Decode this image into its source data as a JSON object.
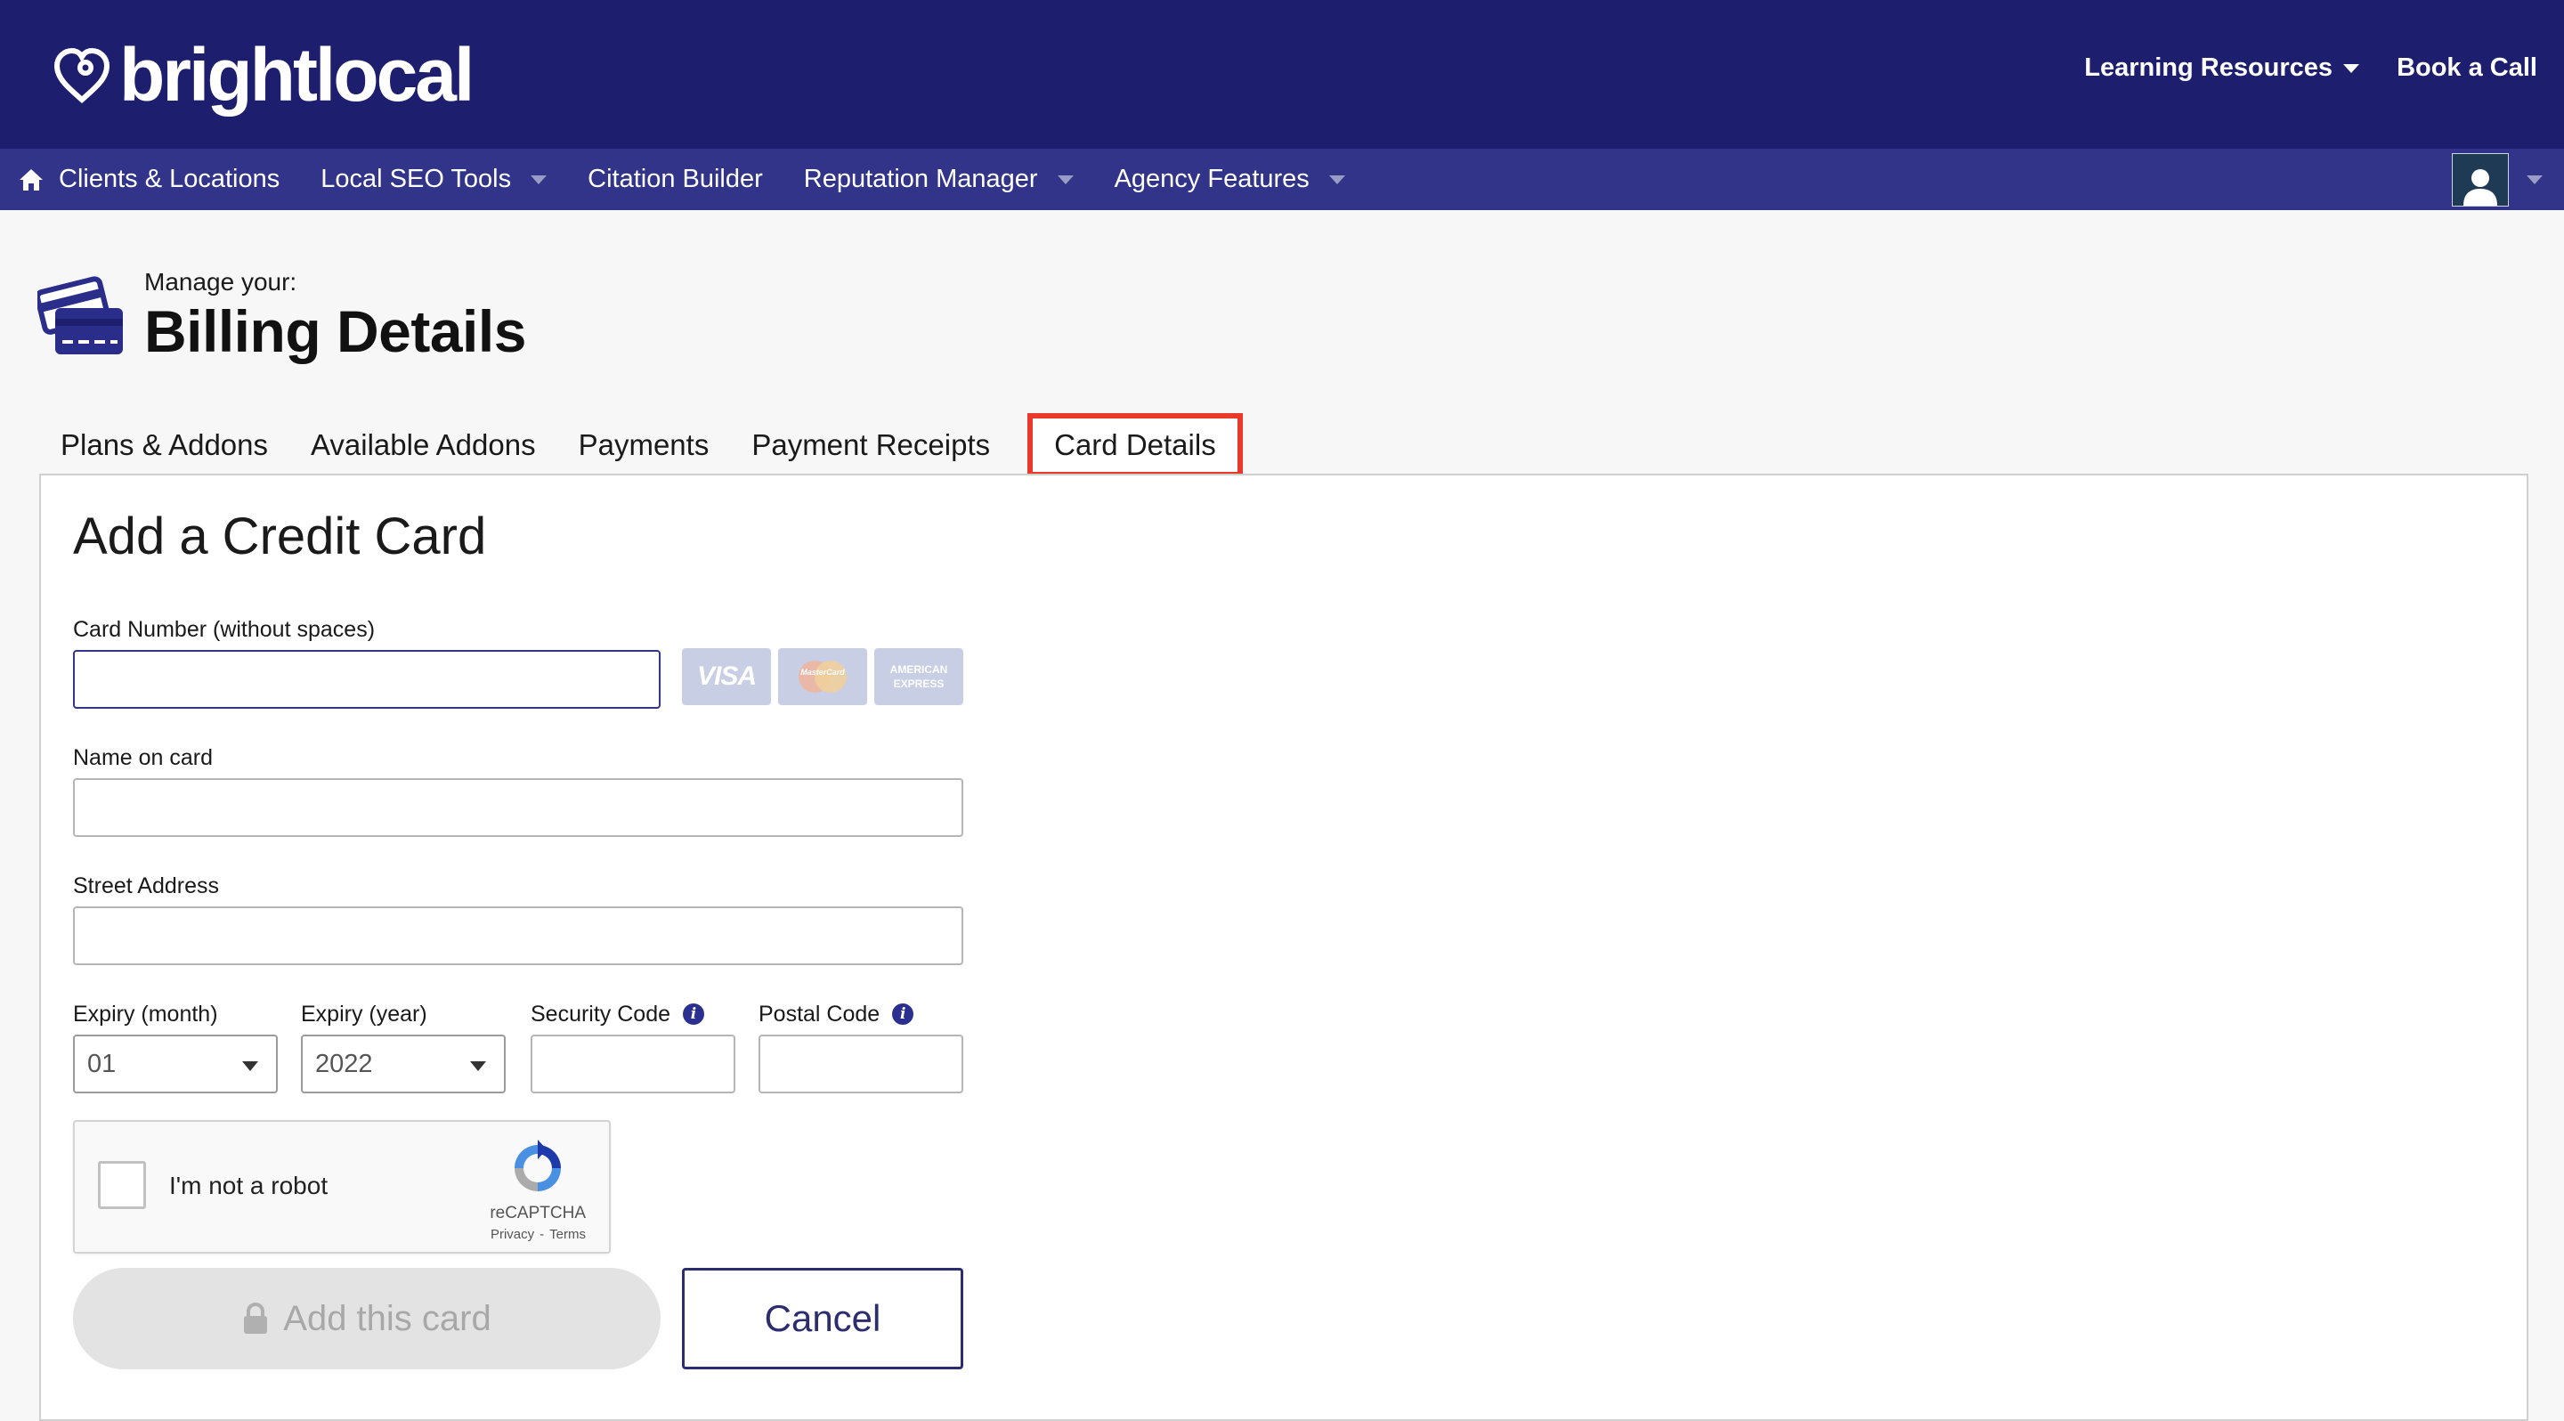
{
  "brand": {
    "name": "brightlocal"
  },
  "top_links": {
    "learning": "Learning Resources",
    "book": "Book a Call"
  },
  "nav": {
    "items": [
      {
        "label": "Clients & Locations"
      },
      {
        "label": "Local SEO Tools"
      },
      {
        "label": "Citation Builder"
      },
      {
        "label": "Reputation Manager"
      },
      {
        "label": "Agency Features"
      }
    ]
  },
  "header": {
    "subtitle": "Manage your:",
    "title": "Billing Details"
  },
  "tabs": [
    {
      "label": "Plans & Addons"
    },
    {
      "label": "Available Addons"
    },
    {
      "label": "Payments"
    },
    {
      "label": "Payment Receipts"
    },
    {
      "label": "Card Details",
      "active": true
    }
  ],
  "form": {
    "title": "Add a Credit Card",
    "card_number": {
      "label": "Card Number (without spaces)",
      "value": "",
      "placeholder": ""
    },
    "card_logos": {
      "visa": "VISA",
      "mastercard": "MasterCard",
      "amex": "AMERICAN EXPRESS"
    },
    "name_on_card": {
      "label": "Name on card",
      "value": ""
    },
    "street_address": {
      "label": "Street Address",
      "value": ""
    },
    "expiry_month": {
      "label": "Expiry (month)",
      "value": "01"
    },
    "expiry_year": {
      "label": "Expiry (year)",
      "value": "2022"
    },
    "security_code": {
      "label": "Security Code",
      "value": ""
    },
    "postal_code": {
      "label": "Postal Code",
      "value": ""
    },
    "recaptcha": {
      "text": "I'm not a robot",
      "brand": "reCAPTCHA",
      "privacy": "Privacy",
      "separator": "-",
      "terms": "Terms"
    },
    "add_button": "Add this card",
    "cancel_button": "Cancel"
  },
  "colors": {
    "brand_bar": "#1d1f6e",
    "nav_bar": "#32348a",
    "highlight": "#e8392b",
    "accent": "#2b2d6e"
  },
  "icons": {
    "home": "home-icon",
    "billing": "credit-card-icon",
    "info": "info-icon",
    "lock": "lock-icon",
    "user": "user-avatar-icon"
  }
}
